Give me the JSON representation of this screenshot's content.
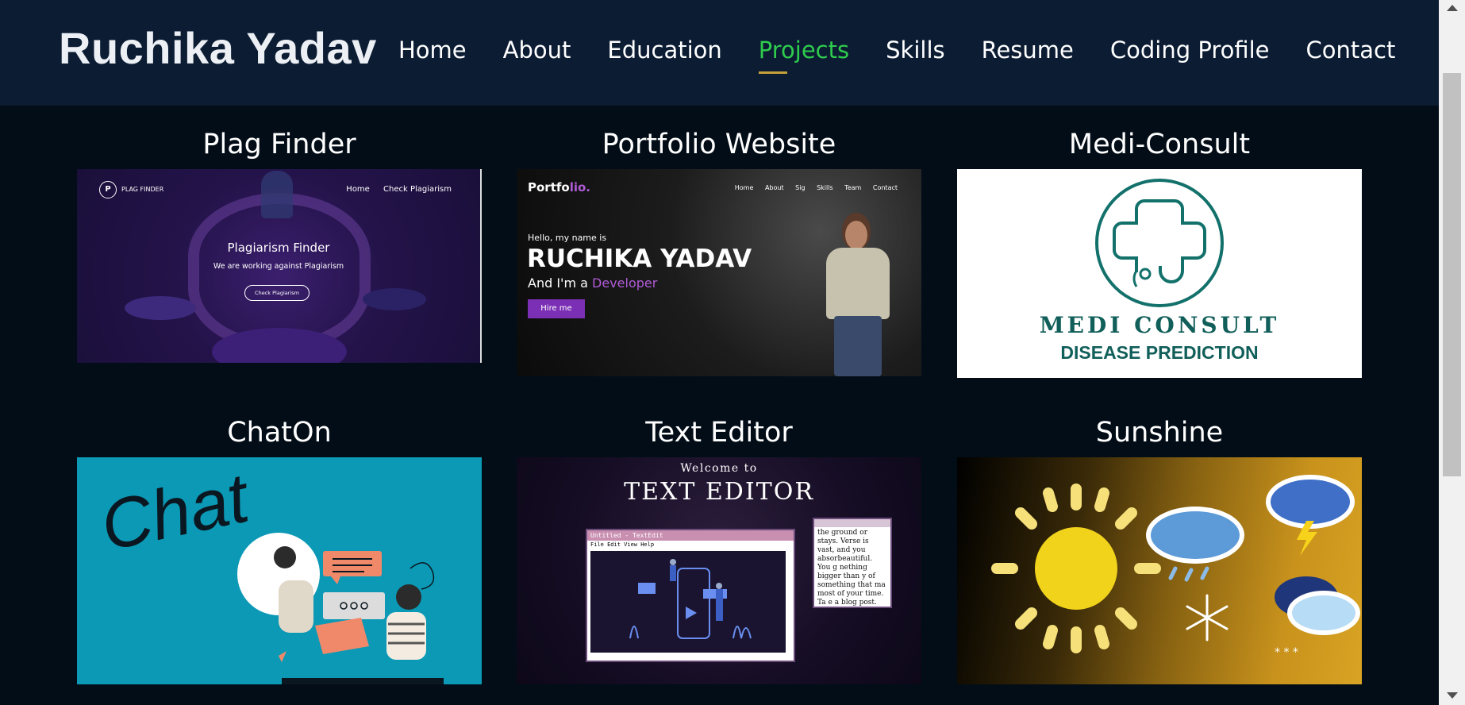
{
  "header": {
    "logo": "Ruchika Yadav",
    "nav": [
      {
        "label": "Home"
      },
      {
        "label": "About"
      },
      {
        "label": "Education"
      },
      {
        "label": "Projects",
        "active": true
      },
      {
        "label": "Skills"
      },
      {
        "label": "Resume"
      },
      {
        "label": "Coding Profile"
      },
      {
        "label": "Contact"
      }
    ]
  },
  "projects": [
    {
      "title": "Plag Finder",
      "thumb": {
        "logo_text": "PLAG FINDER",
        "nav": [
          "Home",
          "Check Plagiarism"
        ],
        "heading": "Plagiarism Finder",
        "subheading": "We are working against Plagiarism",
        "button": "Check Plagiarism"
      }
    },
    {
      "title": "Portfolio Website",
      "thumb": {
        "logo": "Portfo",
        "logo_accent": "lio.",
        "nav": [
          "Home",
          "About",
          "Sig",
          "Skills",
          "Team",
          "Contact"
        ],
        "greeting": "Hello, my name is",
        "name": "RUCHIKA YADAV",
        "role_prefix": "And I'm a",
        "role": "Developer",
        "button": "Hire me"
      }
    },
    {
      "title": "Medi-Consult",
      "thumb": {
        "line1": "MEDI CONSULT",
        "line2": "DISEASE PREDICTION"
      }
    },
    {
      "title": "ChatOn",
      "thumb": {
        "word": "Chat"
      }
    },
    {
      "title": "Text Editor",
      "thumb": {
        "welcome": "Welcome to",
        "heading": "TEXT EDITOR",
        "window_title": "Untitled - TextEdit",
        "menu": "File Edit View Help",
        "snippet": "the ground or stays. Verse is vast, and you absorbeautiful. You g nething bigger than y of something that ma most of your time. Ta e a blog post. Make a"
      }
    },
    {
      "title": "Sunshine",
      "thumb": {}
    }
  ],
  "colors": {
    "header_bg": "#0b1c33",
    "page_bg": "#020d17",
    "nav_active": "#2fcb4d",
    "nav_underline": "#c4a23a",
    "medi_teal": "#115f5a",
    "chat_bg": "#0b99b5"
  }
}
